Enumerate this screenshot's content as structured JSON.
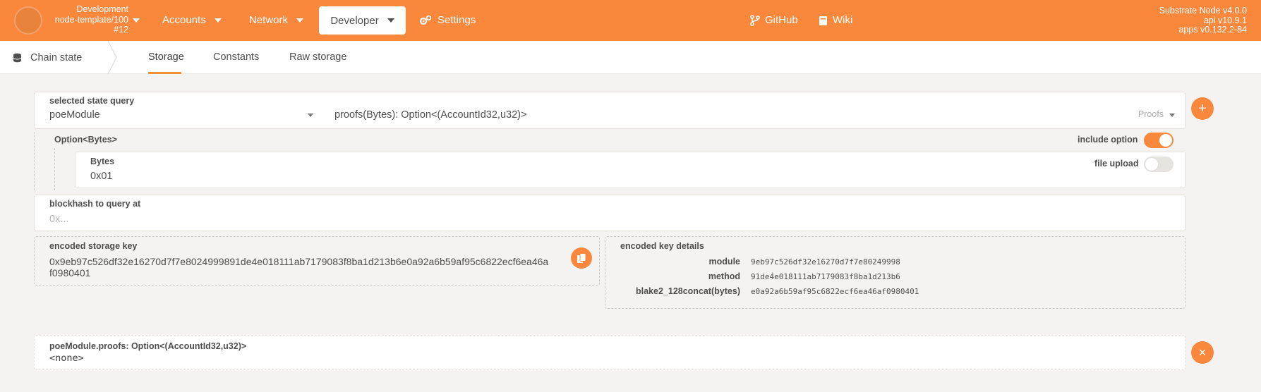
{
  "topbar": {
    "chain": {
      "name": "Development",
      "runtime": "node-template/100",
      "block": "#12"
    },
    "nav": {
      "accounts": "Accounts",
      "network": "Network",
      "developer": "Developer",
      "settings": "Settings",
      "github": "GitHub",
      "wiki": "Wiki"
    },
    "version": {
      "node": "Substrate Node v4.0.0",
      "api": "api v10.9.1",
      "apps": "apps v0.132.2-84"
    }
  },
  "subnav": {
    "section": "Chain state",
    "tabs": [
      "Storage",
      "Constants",
      "Raw storage"
    ],
    "active_tab": "Storage"
  },
  "query": {
    "label": "selected state query",
    "module": "poeModule",
    "method": "proofs(Bytes): Option<(AccountId32,u32)>",
    "method_doc": "Proofs"
  },
  "param": {
    "option_label": "Option<Bytes>",
    "include_option_label": "include option",
    "include_option": true,
    "bytes_label": "Bytes",
    "bytes_value": "0x01",
    "file_upload_label": "file upload",
    "file_upload": false
  },
  "blockhash": {
    "label": "blockhash to query at",
    "placeholder": "0x..."
  },
  "encoded": {
    "label": "encoded storage key",
    "value_line1": "0x9eb97c526df32e16270d7f7e8024999891de4e018111ab7179083f8ba1d213b6e0a92a6b59af95c6822ecf6ea46a",
    "value_line2": "f0980401",
    "details_label": "encoded key details",
    "module_label": "module",
    "module_value": "9eb97c526df32e16270d7f7e80249998",
    "method_label": "method",
    "method_value": "91de4e018111ab7179083f8ba1d213b6",
    "hasher_label": "blake2_128concat(bytes)",
    "hasher_value": "e0a92a6b59af95c6822ecf6ea46af0980401"
  },
  "result": {
    "title": "poeModule.proofs: Option<(AccountId32,u32)>",
    "value": "<none>"
  },
  "colors": {
    "accent": "#f9873c"
  }
}
